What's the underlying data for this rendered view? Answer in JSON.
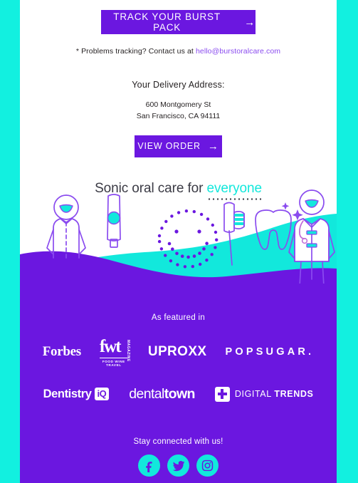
{
  "theme": {
    "purple": "#6B17E0",
    "cyan": "#12E8DC",
    "white": "#FFFFFF",
    "text_dark": "#231F20",
    "link_purple": "#8A4BEF"
  },
  "tracking": {
    "cta_label": "TRACK YOUR BURST PACK",
    "cta_arrow": "→",
    "problems_prefix": "* Problems tracking? Contact us at ",
    "problems_email": "hello@burstoralcare.com"
  },
  "delivery": {
    "title": "Your Delivery Address:",
    "line1": "600 Montgomery St",
    "line2": "San Francisco, CA 94111",
    "cta_label": "VIEW ORDER",
    "cta_arrow": "→"
  },
  "hero": {
    "headline_prefix": "Sonic oral care for ",
    "headline_accent": "everyone",
    "illustration_items": [
      "person-figure",
      "toothpaste-tube",
      "dotted-smiley-face",
      "toothbrush",
      "tooth-with-sparkles",
      "dentist-figure"
    ]
  },
  "featured": {
    "label": "As featured in",
    "row1": [
      {
        "name": "forbes",
        "text": "Forbes"
      },
      {
        "name": "fwt-magazine",
        "text": "fwt",
        "vertical": "MAGAZINE",
        "sub": "FOOD WINE TRAVEL"
      },
      {
        "name": "uproxx",
        "text": "UPROXX"
      },
      {
        "name": "popsugar",
        "text": "POPSUGAR."
      }
    ],
    "row2": [
      {
        "name": "dentistry-iq",
        "text": "Dentistry",
        "badge": "iQ"
      },
      {
        "name": "dentaltown",
        "text_light": "dental",
        "text_bold": "town"
      },
      {
        "name": "digital-trends",
        "text_light": "DIGITAL ",
        "text_bold": "TRENDS"
      }
    ]
  },
  "social": {
    "label": "Stay connected with us!",
    "icons": [
      {
        "name": "facebook-icon",
        "glyph": "f"
      },
      {
        "name": "twitter-icon",
        "glyph": "twitter"
      },
      {
        "name": "instagram-icon",
        "glyph": "instagram"
      }
    ]
  }
}
